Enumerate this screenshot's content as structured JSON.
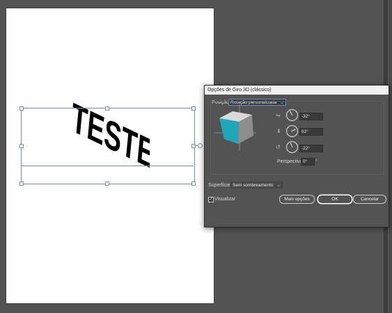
{
  "canvas": {
    "artboard_text": "TESTE",
    "colors": {
      "background": "#535353",
      "artboard": "#ffffff",
      "selection": "#6f8fc4",
      "cube_side": "#1fa6b8"
    }
  },
  "dialog": {
    "title": "Opções de Giro 3D (clássico)",
    "position_label": "Posição:",
    "position_value": "Rotação personalizada",
    "rotation_x": "-32°",
    "rotation_y": "62°",
    "rotation_z": "-22°",
    "perspective_label": "Perspectiva:",
    "perspective_value": "0°",
    "surface_label": "Superfície:",
    "surface_value": "Sem sombreamento",
    "preview_label": "Visualizar",
    "preview_checked": true,
    "more_options_label": "Mais opções",
    "ok_label": "OK",
    "cancel_label": "Cancelar"
  },
  "icons": {
    "x_axis": "rotate-x-icon",
    "y_axis": "rotate-y-icon",
    "z_axis": "rotate-z-icon",
    "dropdown": "chevron-down-icon",
    "stepper": "chevron-right-icon"
  }
}
